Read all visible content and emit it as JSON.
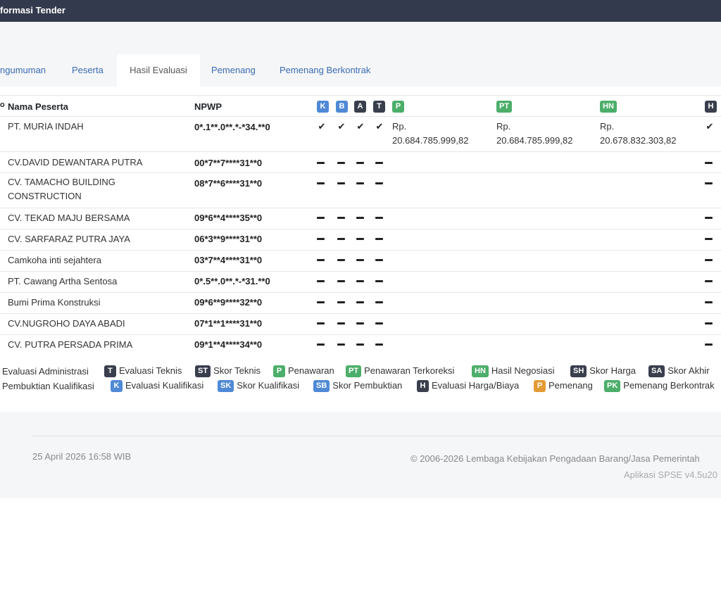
{
  "header": {
    "title": "formasi Tender"
  },
  "tabs": [
    {
      "label": "ngumuman"
    },
    {
      "label": "Peserta"
    },
    {
      "label": "Hasil Evaluasi"
    },
    {
      "label": "Pemenang"
    },
    {
      "label": "Pemenang Berkontrak"
    }
  ],
  "table": {
    "headers": {
      "name": "Nama Peserta",
      "npwp": "NPWP",
      "k": "K",
      "b": "B",
      "a": "A",
      "t": "T",
      "p": "P",
      "pt": "PT",
      "hn": "HN",
      "h": "H"
    },
    "rows": [
      {
        "name": "PT. MURIA INDAH",
        "npwp": "0*.1**.0**.*-*34.**0",
        "p_label": "Rp.",
        "p_value": "20.684.785.999,82",
        "pt_label": "Rp.",
        "pt_value": "20.684.785.999,82",
        "hn_label": "Rp.",
        "hn_value": "20.678.832.303,82"
      },
      {
        "name": "CV.DAVID DEWANTARA PUTRA",
        "npwp": "00*7**7****31**0"
      },
      {
        "name": "CV. TAMACHO BUILDING",
        "name2": "CONSTRUCTION",
        "npwp": "08*7**6****31**0"
      },
      {
        "name": "CV. TEKAD MAJU BERSAMA",
        "npwp": "09*6**4****35**0"
      },
      {
        "name": "CV. SARFARAZ PUTRA JAYA",
        "npwp": "06*3**9****31**0"
      },
      {
        "name": "Camkoha inti sejahtera",
        "npwp": "03*7**4****31**0"
      },
      {
        "name": "PT. Cawang Artha Sentosa",
        "npwp": "0*.5**.0**.*-*31.**0"
      },
      {
        "name": "Bumi Prima Konstruksi",
        "npwp": "09*6**9****32**0"
      },
      {
        "name": "CV.NUGROHO DAYA ABADI",
        "npwp": "07*1**1****31**0"
      },
      {
        "name": "CV. PUTRA PERSADA PRIMA",
        "npwp": "09*1**4****34**0"
      }
    ]
  },
  "legend": {
    "row1": [
      {
        "badge": "",
        "label": "Evaluasi Administrasi"
      },
      {
        "badge": "T",
        "label": "Evaluasi Teknis",
        "color": "#3a3f4d"
      },
      {
        "badge": "ST",
        "label": "Skor Teknis",
        "color": "#3a3f4d"
      },
      {
        "badge": "P",
        "label": "Penawaran",
        "color": "#4cae6a"
      },
      {
        "badge": "PT",
        "label": "Penawaran Terkoreksi",
        "color": "#4cae6a"
      },
      {
        "badge": "HN",
        "label": "Hasil Negosiasi",
        "color": "#4cae6a"
      },
      {
        "badge": "SH",
        "label": "Skor Harga",
        "color": "#3a3f4d"
      },
      {
        "badge": "SA",
        "label": "Skor Akhir",
        "color": "#3a3f4d"
      }
    ],
    "row2": [
      {
        "badge": "",
        "label": "Pembuktian Kualifikasi"
      },
      {
        "badge": "K",
        "label": "Evaluasi Kualifikasi",
        "color": "#4f89d6"
      },
      {
        "badge": "SK",
        "label": "Skor Kualifikasi",
        "color": "#4f89d6"
      },
      {
        "badge": "SB",
        "label": "Skor Pembuktian",
        "color": "#4f89d6"
      },
      {
        "badge": "H",
        "label": "Evaluasi Harga/Biaya",
        "color": "#3a3f4d"
      },
      {
        "badge": "P",
        "label": "Pemenang",
        "color": "#e49a35"
      },
      {
        "badge": "PK",
        "label": "Pemenang Berkontrak",
        "color": "#4cae6a"
      }
    ]
  },
  "footer": {
    "date": "25 April 2026 16:58 WIB",
    "copyright": "© 2006-2026 Lembaga Kebijakan Pengadaan Barang/Jasa Pemerintah",
    "app": "Aplikasi SPSE v4.5u20"
  }
}
